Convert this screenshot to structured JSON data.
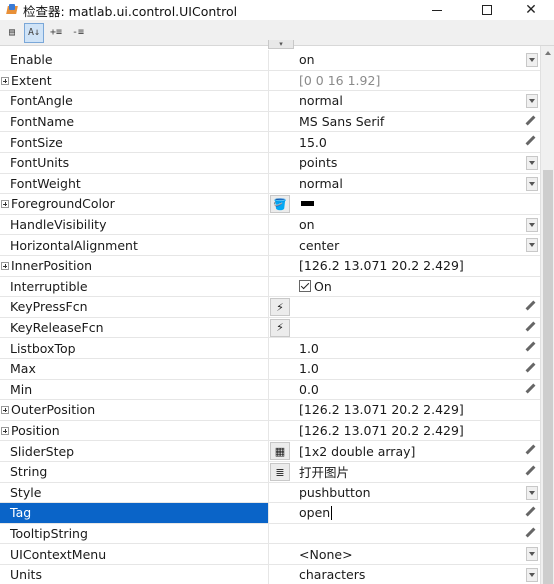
{
  "window": {
    "title": "检查器: matlab.ui.control.UIControl"
  },
  "toolbar": {
    "buttons": [
      {
        "name": "categorized-view-icon",
        "glyph": "▤",
        "active": false
      },
      {
        "name": "sort-alphabetical-icon",
        "glyph": "A↓",
        "active": true
      },
      {
        "name": "expand-all-icon",
        "glyph": "+≡",
        "active": false
      },
      {
        "name": "collapse-all-icon",
        "glyph": "-≡",
        "active": false
      }
    ]
  },
  "properties": [
    {
      "name": "Enable",
      "value": "on",
      "expandable": false,
      "editor": "dropdown",
      "button": null
    },
    {
      "name": "Extent",
      "value": "[0 0 16 1.92]",
      "expandable": true,
      "editor": "none",
      "button": null,
      "dim": true
    },
    {
      "name": "FontAngle",
      "value": "normal",
      "expandable": false,
      "editor": "dropdown",
      "button": null
    },
    {
      "name": "FontName",
      "value": "MS Sans Serif",
      "expandable": false,
      "editor": "pencil",
      "button": null
    },
    {
      "name": "FontSize",
      "value": "15.0",
      "expandable": false,
      "editor": "pencil",
      "button": null
    },
    {
      "name": "FontUnits",
      "value": "points",
      "expandable": false,
      "editor": "dropdown",
      "button": null
    },
    {
      "name": "FontWeight",
      "value": "normal",
      "expandable": false,
      "editor": "dropdown",
      "button": null
    },
    {
      "name": "ForegroundColor",
      "value": "",
      "expandable": true,
      "editor": "none",
      "button": "paint-bucket-icon",
      "swatch": "#000000"
    },
    {
      "name": "HandleVisibility",
      "value": "on",
      "expandable": false,
      "editor": "dropdown",
      "button": null
    },
    {
      "name": "HorizontalAlignment",
      "value": "center",
      "expandable": false,
      "editor": "dropdown",
      "button": null
    },
    {
      "name": "InnerPosition",
      "value": "[126.2 13.071 20.2 2.429]",
      "expandable": true,
      "editor": "none",
      "button": null
    },
    {
      "name": "Interruptible",
      "value": "On",
      "expandable": false,
      "editor": "none",
      "button": null,
      "checkbox": true
    },
    {
      "name": "KeyPressFcn",
      "value": "",
      "expandable": false,
      "editor": "pencil",
      "button": "callback-icon"
    },
    {
      "name": "KeyReleaseFcn",
      "value": "",
      "expandable": false,
      "editor": "pencil",
      "button": "callback-icon"
    },
    {
      "name": "ListboxTop",
      "value": "1.0",
      "expandable": false,
      "editor": "pencil",
      "button": null
    },
    {
      "name": "Max",
      "value": "1.0",
      "expandable": false,
      "editor": "pencil",
      "button": null
    },
    {
      "name": "Min",
      "value": "0.0",
      "expandable": false,
      "editor": "pencil",
      "button": null
    },
    {
      "name": "OuterPosition",
      "value": "[126.2 13.071 20.2 2.429]",
      "expandable": true,
      "editor": "none",
      "button": null
    },
    {
      "name": "Position",
      "value": "[126.2 13.071 20.2 2.429]",
      "expandable": true,
      "editor": "none",
      "button": null
    },
    {
      "name": "SliderStep",
      "value": "[1x2  double array]",
      "expandable": false,
      "editor": "pencil",
      "button": "array-editor-icon"
    },
    {
      "name": "String",
      "value": "打开图片",
      "expandable": false,
      "editor": "pencil",
      "button": "text-editor-icon"
    },
    {
      "name": "Style",
      "value": "pushbutton",
      "expandable": false,
      "editor": "dropdown",
      "button": null
    },
    {
      "name": "Tag",
      "value": "open",
      "expandable": false,
      "editor": "pencil",
      "button": null,
      "selected": true
    },
    {
      "name": "TooltipString",
      "value": "",
      "expandable": false,
      "editor": "pencil",
      "button": null
    },
    {
      "name": "UIContextMenu",
      "value": "<None>",
      "expandable": false,
      "editor": "dropdown",
      "button": null
    },
    {
      "name": "Units",
      "value": "characters",
      "expandable": false,
      "editor": "dropdown",
      "button": null
    }
  ]
}
